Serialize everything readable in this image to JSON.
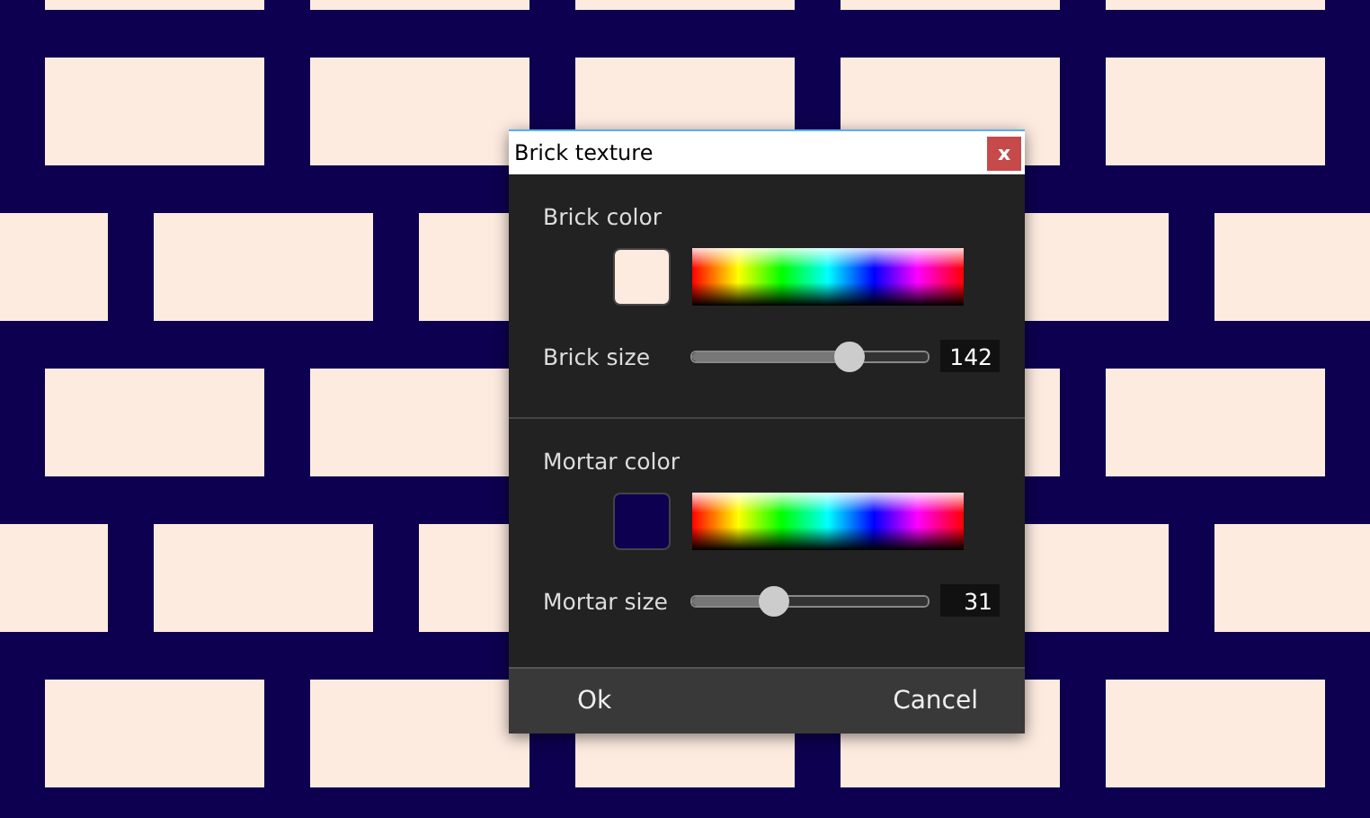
{
  "window": {
    "title": "Brick texture",
    "close": "x"
  },
  "sections": [
    {
      "color_label": "Brick color",
      "color": "#fdebe0",
      "size_label": "Brick size",
      "level": 0.68,
      "reading": "142"
    },
    {
      "color_label": "Mortar color",
      "color": "#0d0050",
      "size_label": "Mortar size",
      "level": 0.32,
      "reading": "31"
    }
  ],
  "buttons": [
    "Ok",
    "Cancel"
  ]
}
